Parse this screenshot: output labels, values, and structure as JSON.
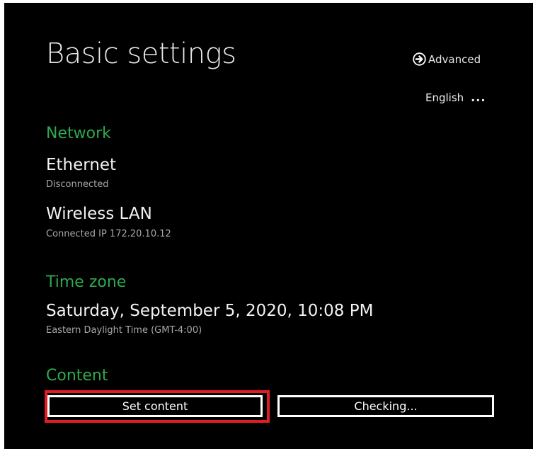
{
  "header": {
    "title": "Basic settings",
    "advanced_label": "Advanced",
    "advanced_icon": "arrow-right-circle-icon",
    "language": "English",
    "language_more": "..."
  },
  "network": {
    "heading": "Network",
    "ethernet": {
      "name": "Ethernet",
      "status": "Disconnected"
    },
    "wireless": {
      "name": "Wireless LAN",
      "status": "Connected IP 172.20.10.12"
    }
  },
  "time_zone": {
    "heading": "Time zone",
    "datetime": "Saturday, September 5, 2020, 10:08 PM",
    "zone": "Eastern Daylight Time (GMT-4:00)"
  },
  "content": {
    "heading": "Content",
    "set_content_label": "Set content",
    "checking_label": "Checking..."
  },
  "colors": {
    "background": "#000000",
    "section_heading": "#2fa84f",
    "highlight": "#e31b23",
    "text_primary": "#f2f2f2",
    "text_secondary": "#a8a8a8"
  }
}
